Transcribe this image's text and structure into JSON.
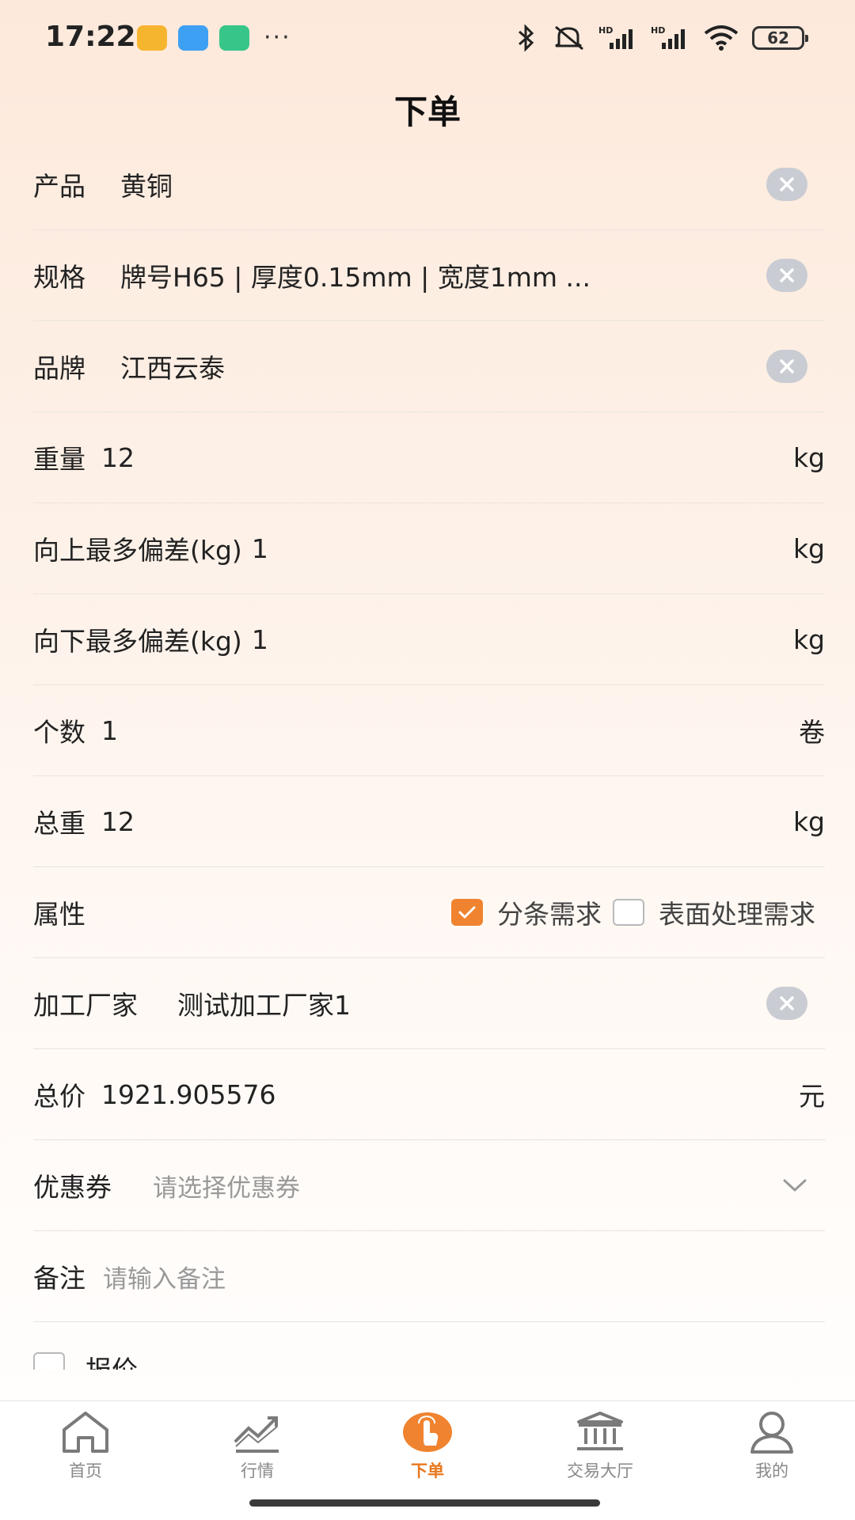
{
  "status_bar": {
    "time": "17:22",
    "battery": "62"
  },
  "header": {
    "title": "下单"
  },
  "form": {
    "product": {
      "label": "产品",
      "value": "黄铜"
    },
    "spec": {
      "label": "规格",
      "value": "牌号H65 | 厚度0.15mm | 宽度1mm ..."
    },
    "brand": {
      "label": "品牌",
      "value": "江西云泰"
    },
    "weight": {
      "label": "重量",
      "value": "12",
      "unit": "kg"
    },
    "upper_dev": {
      "label": "向上最多偏差(kg)",
      "value": "1",
      "unit": "kg"
    },
    "lower_dev": {
      "label": "向下最多偏差(kg)",
      "value": "1",
      "unit": "kg"
    },
    "count": {
      "label": "个数",
      "value": "1",
      "unit": "卷"
    },
    "total_weight": {
      "label": "总重",
      "value": "12",
      "unit": "kg"
    },
    "attributes": {
      "label": "属性",
      "options": [
        {
          "label": "分条需求",
          "checked": true
        },
        {
          "label": "表面处理需求",
          "checked": false
        }
      ]
    },
    "factory": {
      "label": "加工厂家",
      "value": "测试加工厂家1"
    },
    "total_price": {
      "label": "总价",
      "value": "1921.905576",
      "unit": "元"
    },
    "coupon": {
      "label": "优惠券",
      "placeholder": "请选择优惠券"
    },
    "remark": {
      "label": "备注",
      "placeholder": "请输入备注"
    },
    "partial": {
      "label": "报价..."
    }
  },
  "tabbar": {
    "items": [
      {
        "label": "首页",
        "icon": "home-icon",
        "active": false
      },
      {
        "label": "行情",
        "icon": "market-chart-icon",
        "active": false
      },
      {
        "label": "下单",
        "icon": "order-tap-icon",
        "active": true
      },
      {
        "label": "交易大厅",
        "icon": "bank-hall-icon",
        "active": false
      },
      {
        "label": "我的",
        "icon": "user-icon",
        "active": false
      }
    ]
  },
  "colors": {
    "accent": "#f0832f",
    "tab_active": "#e8781e",
    "clear_bg": "#c9ccd2"
  }
}
